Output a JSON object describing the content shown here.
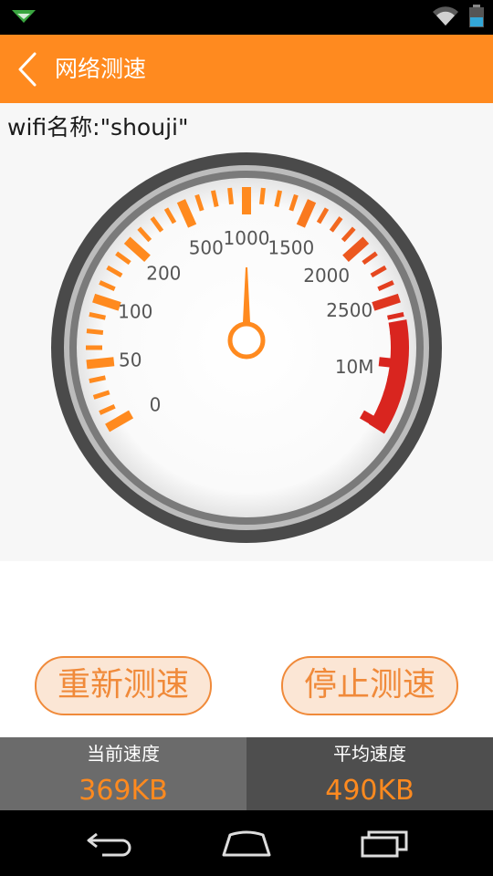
{
  "app_bar": {
    "title": "网络测速"
  },
  "wifi": {
    "text": "wifi名称:\"shouji\""
  },
  "gauge": {
    "labels": [
      "0",
      "50",
      "100",
      "200",
      "500",
      "1000",
      "1500",
      "2000",
      "2500",
      "10M"
    ],
    "needle_value": "1000",
    "colors": {
      "scale_low": "#ff8a1f",
      "scale_high": "#d9251f",
      "needle": "#ff8a1f"
    }
  },
  "buttons": {
    "restart": "重新测速",
    "stop": "停止测速"
  },
  "stats": {
    "current": {
      "label": "当前速度",
      "value": "369KB"
    },
    "average": {
      "label": "平均速度",
      "value": "490KB"
    }
  },
  "colors": {
    "accent": "#ff8a1f",
    "status_bar": "#000000",
    "nav_bar": "#000000"
  },
  "icons": [
    "notification-icon",
    "wifi-icon",
    "battery-icon",
    "back-icon",
    "nav-back-icon",
    "nav-home-icon",
    "nav-recents-icon"
  ]
}
